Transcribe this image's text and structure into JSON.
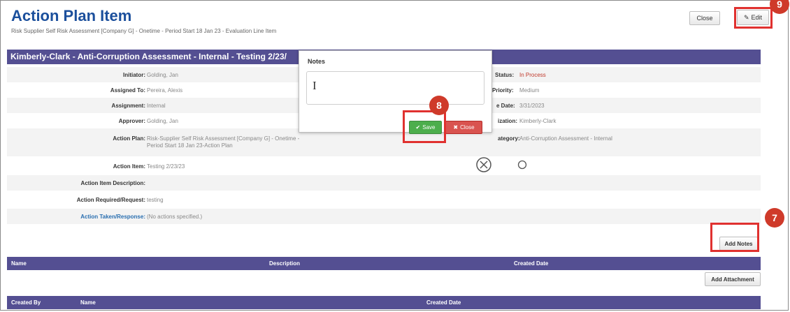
{
  "header": {
    "title": "Action Plan Item",
    "subtitle": "Risk Supplier Self Risk Assessment [Company G] - Onetime - Period Start 18 Jan 23 - Evaluation Line Item",
    "close_label": "Close",
    "edit_label": "Edit"
  },
  "record": {
    "title": "Kimberly-Clark - Anti-Corruption Assessment - Internal - Testing 2/23/",
    "left_fields": [
      {
        "label": "Initiator:",
        "value": "Golding, Jan"
      },
      {
        "label": "Assigned To:",
        "value": "Pereira, Alexis"
      },
      {
        "label": "Assignment:",
        "value": "Internal"
      },
      {
        "label": "Approver:",
        "value": "Golding, Jan"
      },
      {
        "label": "Action Plan:",
        "value": "Risk-Supplier Self Risk Assessment [Company G] - Onetime - Period Start 18 Jan 23-Action Plan"
      },
      {
        "label": "Action Item:",
        "value": "Testing 2/23/23"
      },
      {
        "label": "Action Item Description:",
        "value": ""
      },
      {
        "label": "Action Required/Request:",
        "value": "testing"
      },
      {
        "label": "Action Taken/Response:",
        "value": "(No actions specified.)"
      }
    ],
    "right_fields": [
      {
        "label": "Status:",
        "value": "In Process"
      },
      {
        "label": "Priority:",
        "value": "Medium"
      },
      {
        "label": "e Date:",
        "value": "3/31/2023"
      },
      {
        "label": "ization:",
        "value": "Kimberly-Clark"
      },
      {
        "label": "ategory:",
        "value": "Anti-Corruption Assessment - Internal"
      }
    ]
  },
  "notes_grid": {
    "add_label": "Add Notes",
    "columns": [
      "Name",
      "Description",
      "Created Date"
    ]
  },
  "attachments_grid": {
    "add_label": "Add Attachment",
    "columns": [
      "Created By",
      "Name",
      "Created Date"
    ]
  },
  "modal": {
    "title": "Notes",
    "text_value": "",
    "save_label": "Save",
    "close_label": "Close"
  },
  "callouts": {
    "seven": "7",
    "eight": "8",
    "nine": "9"
  },
  "colors": {
    "accent": "#544f92",
    "title_blue": "#1b4f9c",
    "callout_red": "#cf3a2a",
    "save_green": "#4cae4c",
    "close_red": "#d9534f",
    "status_red": "#c0392b"
  },
  "icons": [
    "pencil-icon",
    "checkmark-icon",
    "x-icon",
    "circle-x-icon",
    "circle-icon",
    "text-cursor-icon"
  ]
}
